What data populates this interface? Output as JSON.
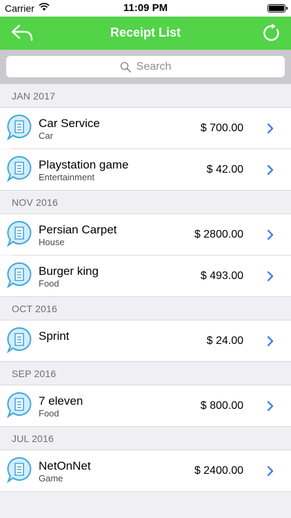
{
  "status_bar": {
    "carrier": "Carrier",
    "time": "11:09 PM"
  },
  "nav": {
    "title": "Receipt List",
    "back_icon": "back-arrow-icon",
    "refresh_icon": "refresh-icon"
  },
  "search": {
    "placeholder": "Search"
  },
  "sections": [
    {
      "header": "JAN 2017",
      "items": [
        {
          "title": "Car Service",
          "subtitle": "Car",
          "amount": "$ 700.00"
        },
        {
          "title": "Playstation game",
          "subtitle": "Entertainment",
          "amount": "$ 42.00"
        }
      ]
    },
    {
      "header": "NOV 2016",
      "items": [
        {
          "title": "Persian Carpet",
          "subtitle": "House",
          "amount": "$ 2800.00"
        },
        {
          "title": "Burger king",
          "subtitle": "Food",
          "amount": "$ 493.00"
        }
      ]
    },
    {
      "header": "OCT 2016",
      "items": [
        {
          "title": "Sprint",
          "subtitle": "",
          "amount": "$ 24.00"
        }
      ]
    },
    {
      "header": "SEP 2016",
      "items": [
        {
          "title": "7 eleven",
          "subtitle": "Food",
          "amount": "$ 800.00"
        }
      ]
    },
    {
      "header": "JUL 2016",
      "items": [
        {
          "title": "NetOnNet",
          "subtitle": "Game",
          "amount": "$ 2400.00"
        }
      ]
    }
  ],
  "colors": {
    "nav_green": "#52d348",
    "chevron_blue": "#4a7ee8",
    "icon_blue": "#3da8e0"
  }
}
